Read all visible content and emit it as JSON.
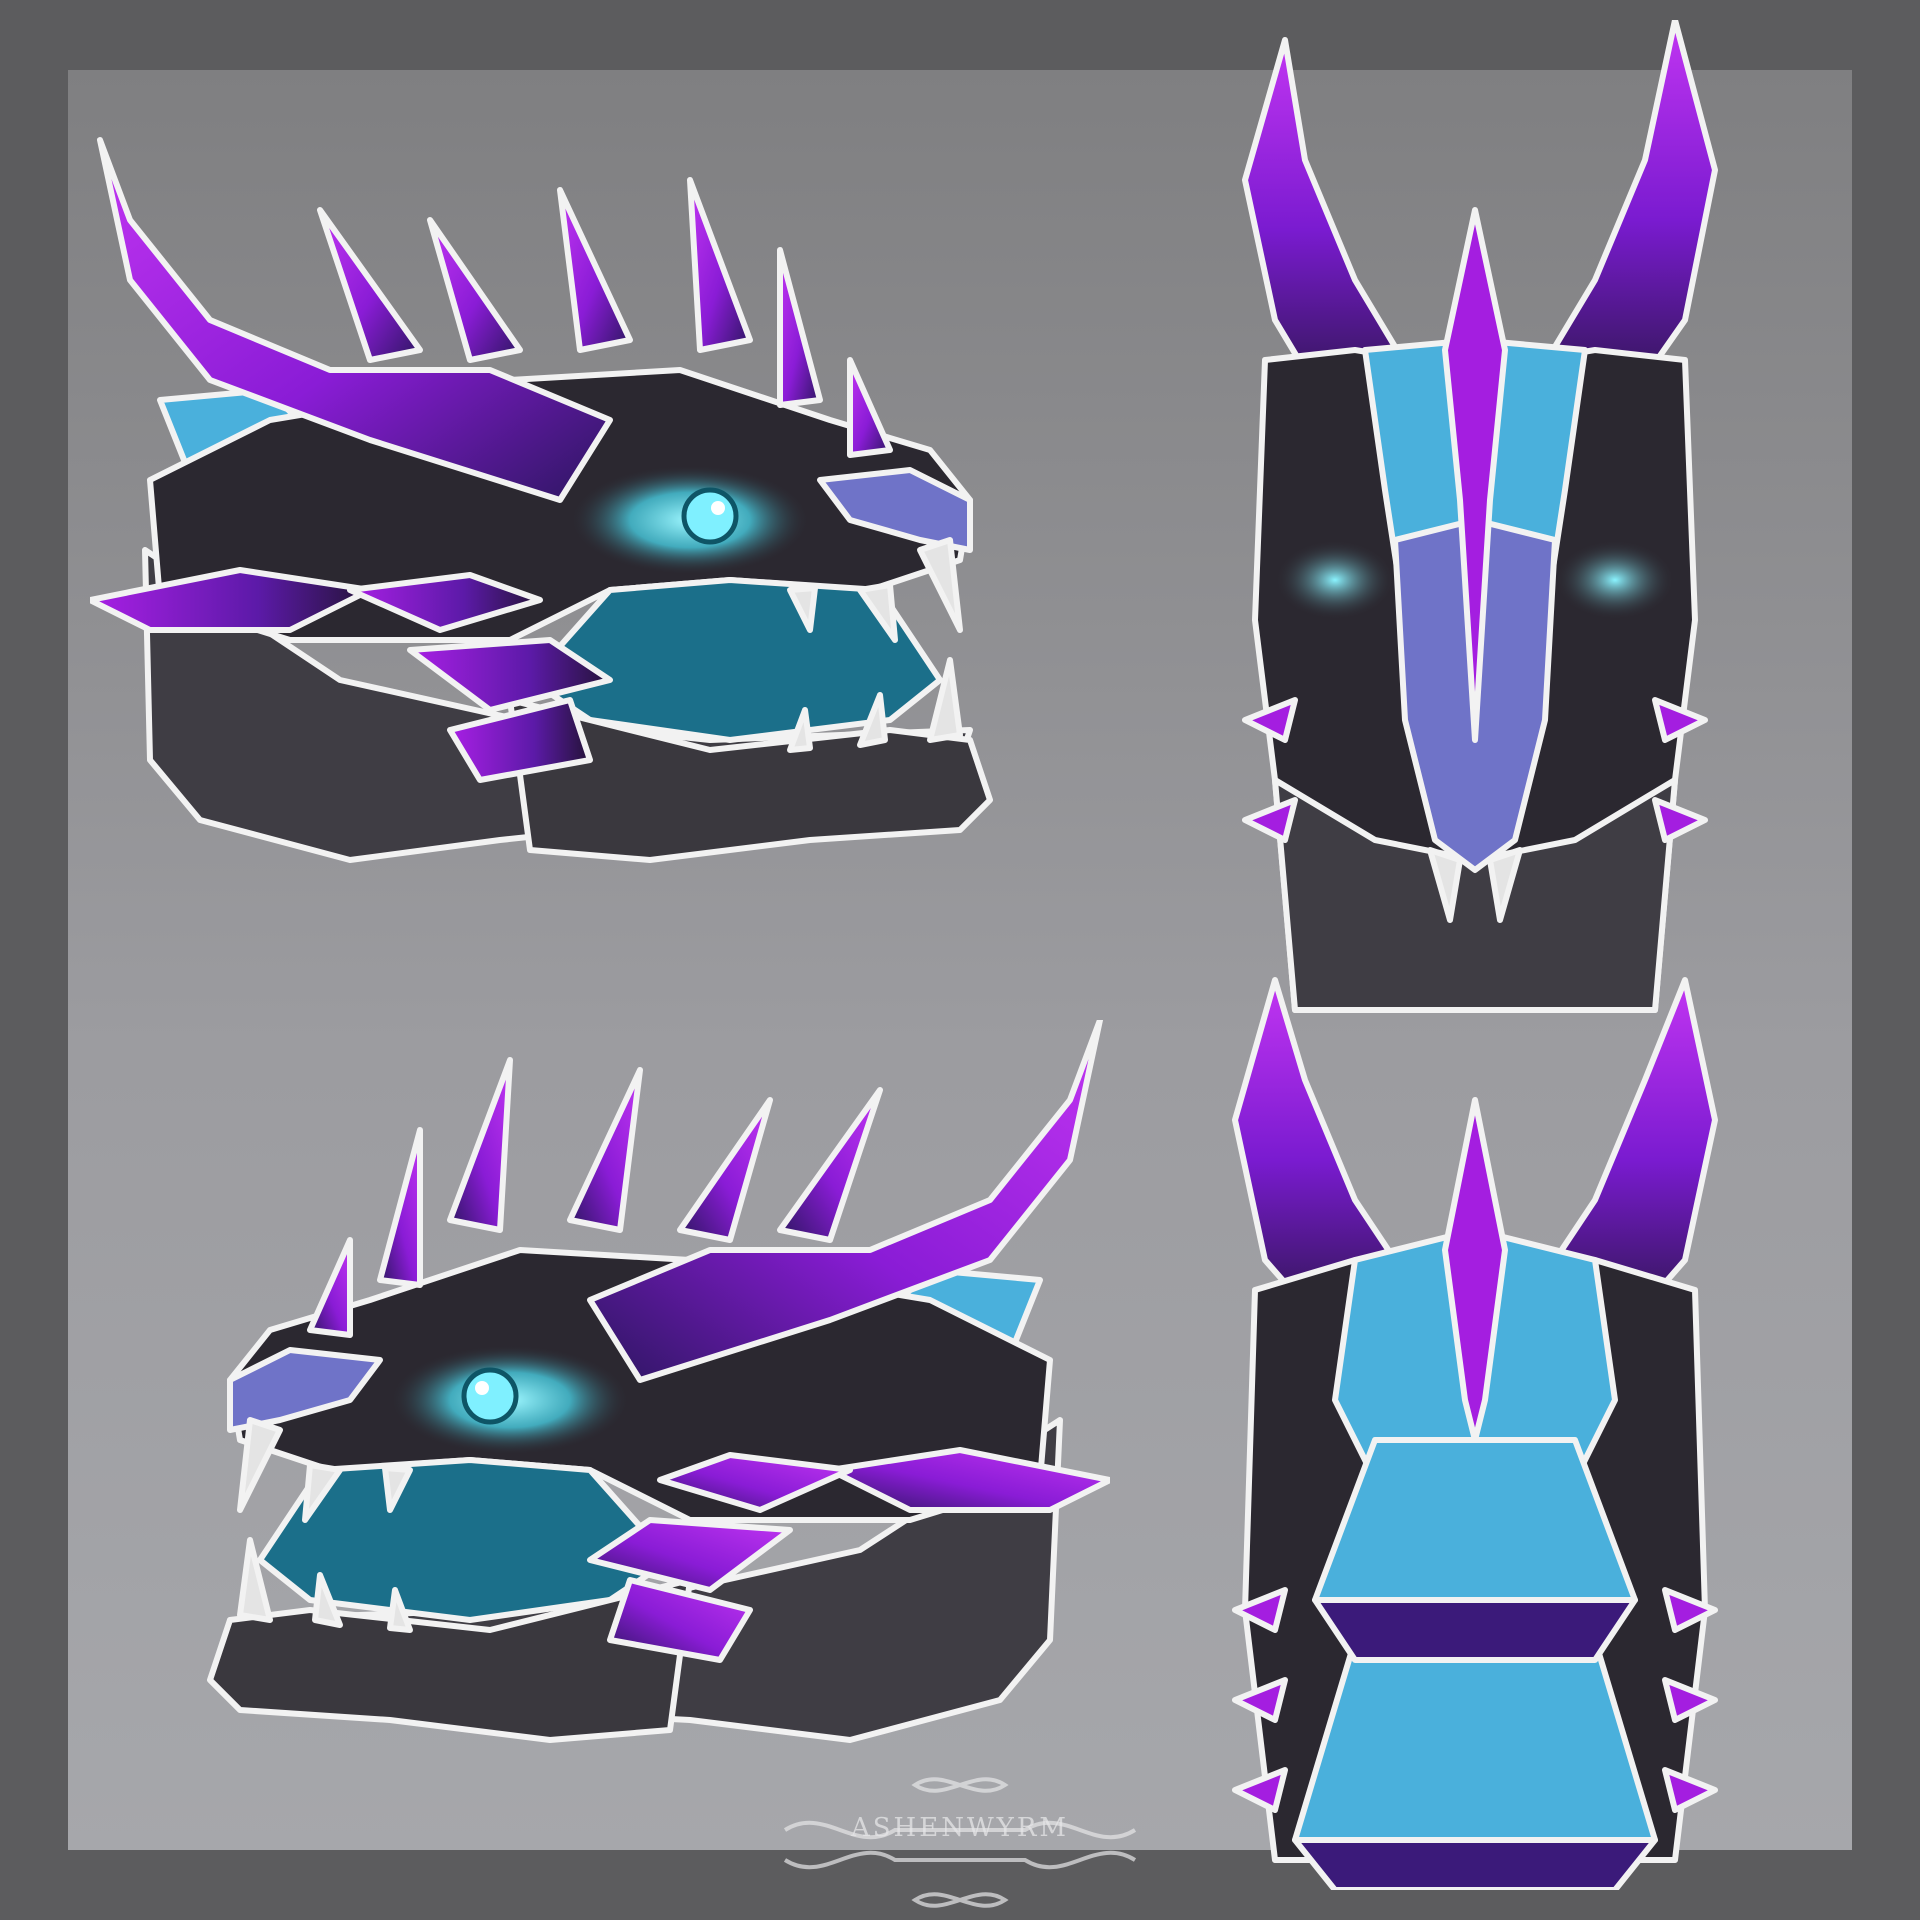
{
  "artwork": {
    "subject": "dragon-head-reference-sheet",
    "views": [
      {
        "id": "side-right",
        "label": ""
      },
      {
        "id": "side-left",
        "label": ""
      },
      {
        "id": "front",
        "label": ""
      },
      {
        "id": "top",
        "label": ""
      }
    ]
  },
  "watermark": {
    "text": "ASHENWYRM"
  },
  "colors": {
    "background_outer": "#5c5c5e",
    "frame_top": "#7f7f81",
    "frame_bottom": "#a6a7ab",
    "scales_dark": "#2b2830",
    "scales_mid": "#3f3d44",
    "galaxy_purple": "#a41ee0",
    "galaxy_deep": "#3b1a7a",
    "crest_blue": "#4ab0dc",
    "snout_periwinkle": "#6f73c8",
    "eye_glow": "#7ff0ff",
    "mouth_teal": "#1b6f8a",
    "teeth": "#e4e4e4"
  }
}
